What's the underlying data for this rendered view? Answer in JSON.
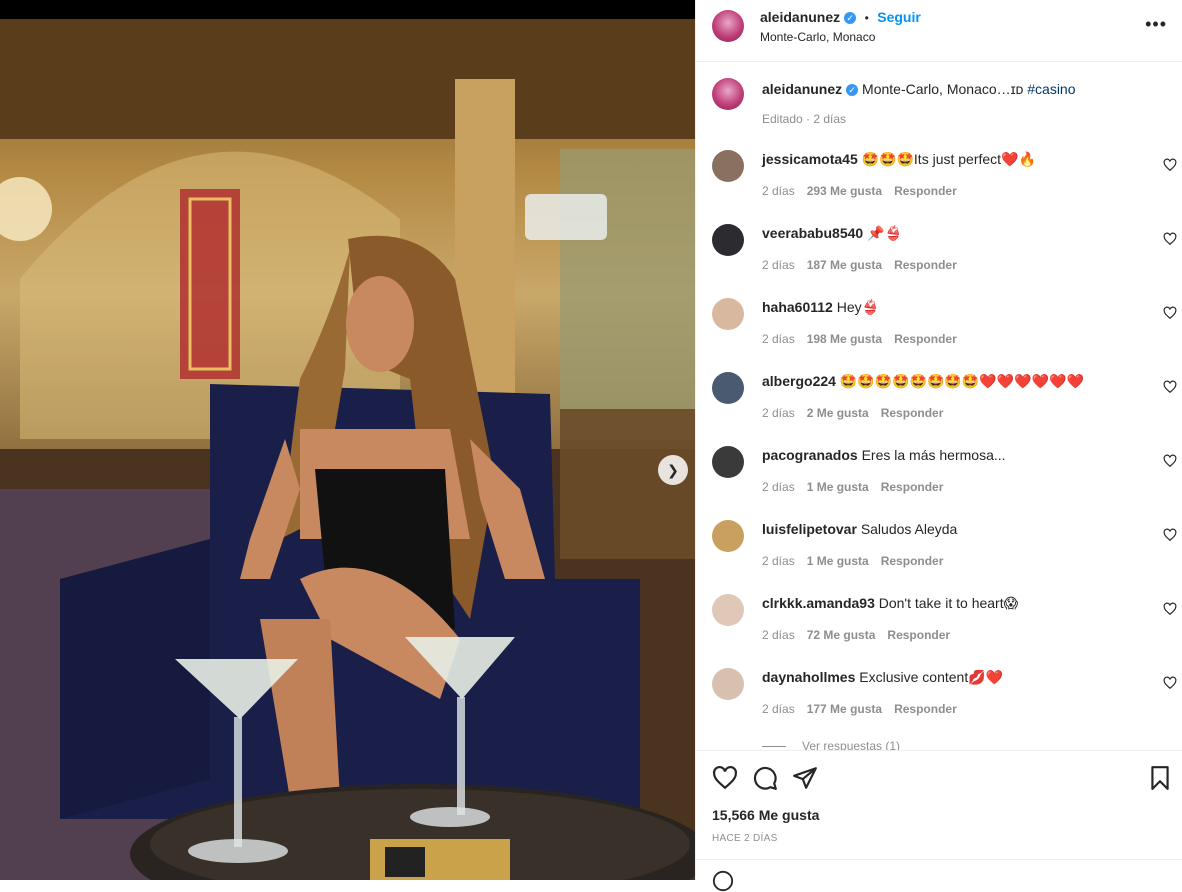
{
  "post": {
    "image_alt": "Woman seated in a velvet armchair in a casino with two martini glasses",
    "carousel": {
      "dots": 3,
      "active": 1
    }
  },
  "header": {
    "username": "aleidanunez",
    "separator": "•",
    "follow_label": "Seguir",
    "location": "Monte-Carlo, Monaco",
    "more_label": "•••"
  },
  "caption": {
    "username": "aleidanunez",
    "text": "Monte-Carlo, Monaco…ɪᴅ",
    "hashtag": "#casino",
    "meta": "Editado · 2 días"
  },
  "comments": [
    {
      "user": "jessicamota45",
      "text": "🤩🤩🤩Its just perfect❤️🔥",
      "time": "2 días",
      "likes": "293 Me gusta",
      "reply": "Responder",
      "avatar": "#8a7060"
    },
    {
      "user": "veerababu8540",
      "text": "📌👙",
      "time": "2 días",
      "likes": "187 Me gusta",
      "reply": "Responder",
      "avatar": "#2b2b30"
    },
    {
      "user": "haha60112",
      "text": "Hey👙",
      "time": "2 días",
      "likes": "198 Me gusta",
      "reply": "Responder",
      "avatar": "#d9b8a0"
    },
    {
      "user": "albergo224",
      "text": "🤩🤩🤩🤩🤩🤩🤩🤩❤️❤️❤️❤️❤️❤️",
      "time": "2 días",
      "likes": "2 Me gusta",
      "reply": "Responder",
      "avatar": "#4a5a70"
    },
    {
      "user": "pacogranados",
      "text": "Eres la más hermosa...",
      "time": "2 días",
      "likes": "1 Me gusta",
      "reply": "Responder",
      "avatar": "#3a3a3a"
    },
    {
      "user": "luisfelipetovar",
      "text": "Saludos Aleyda",
      "time": "2 días",
      "likes": "1 Me gusta",
      "reply": "Responder",
      "avatar": "#c9a060"
    },
    {
      "user": "clrkkk.amanda93",
      "text": "Don't take it to heart😱",
      "time": "2 días",
      "likes": "72 Me gusta",
      "reply": "Responder",
      "avatar": "#e0c8b8"
    },
    {
      "user": "daynahollmes",
      "text": "Exclusive content💋❤️",
      "time": "2 días",
      "likes": "177 Me gusta",
      "reply": "Responder",
      "avatar": "#d8c0b0"
    }
  ],
  "view_replies": "Ver respuestas (1)",
  "footer": {
    "likes": "15,566 Me gusta",
    "timestamp": "HACE 2 DÍAS"
  },
  "colors": {
    "accent": "#0095f6",
    "verified": "#3897f0",
    "muted": "#8e8e8e",
    "text": "#262626",
    "divider": "#efefef"
  }
}
